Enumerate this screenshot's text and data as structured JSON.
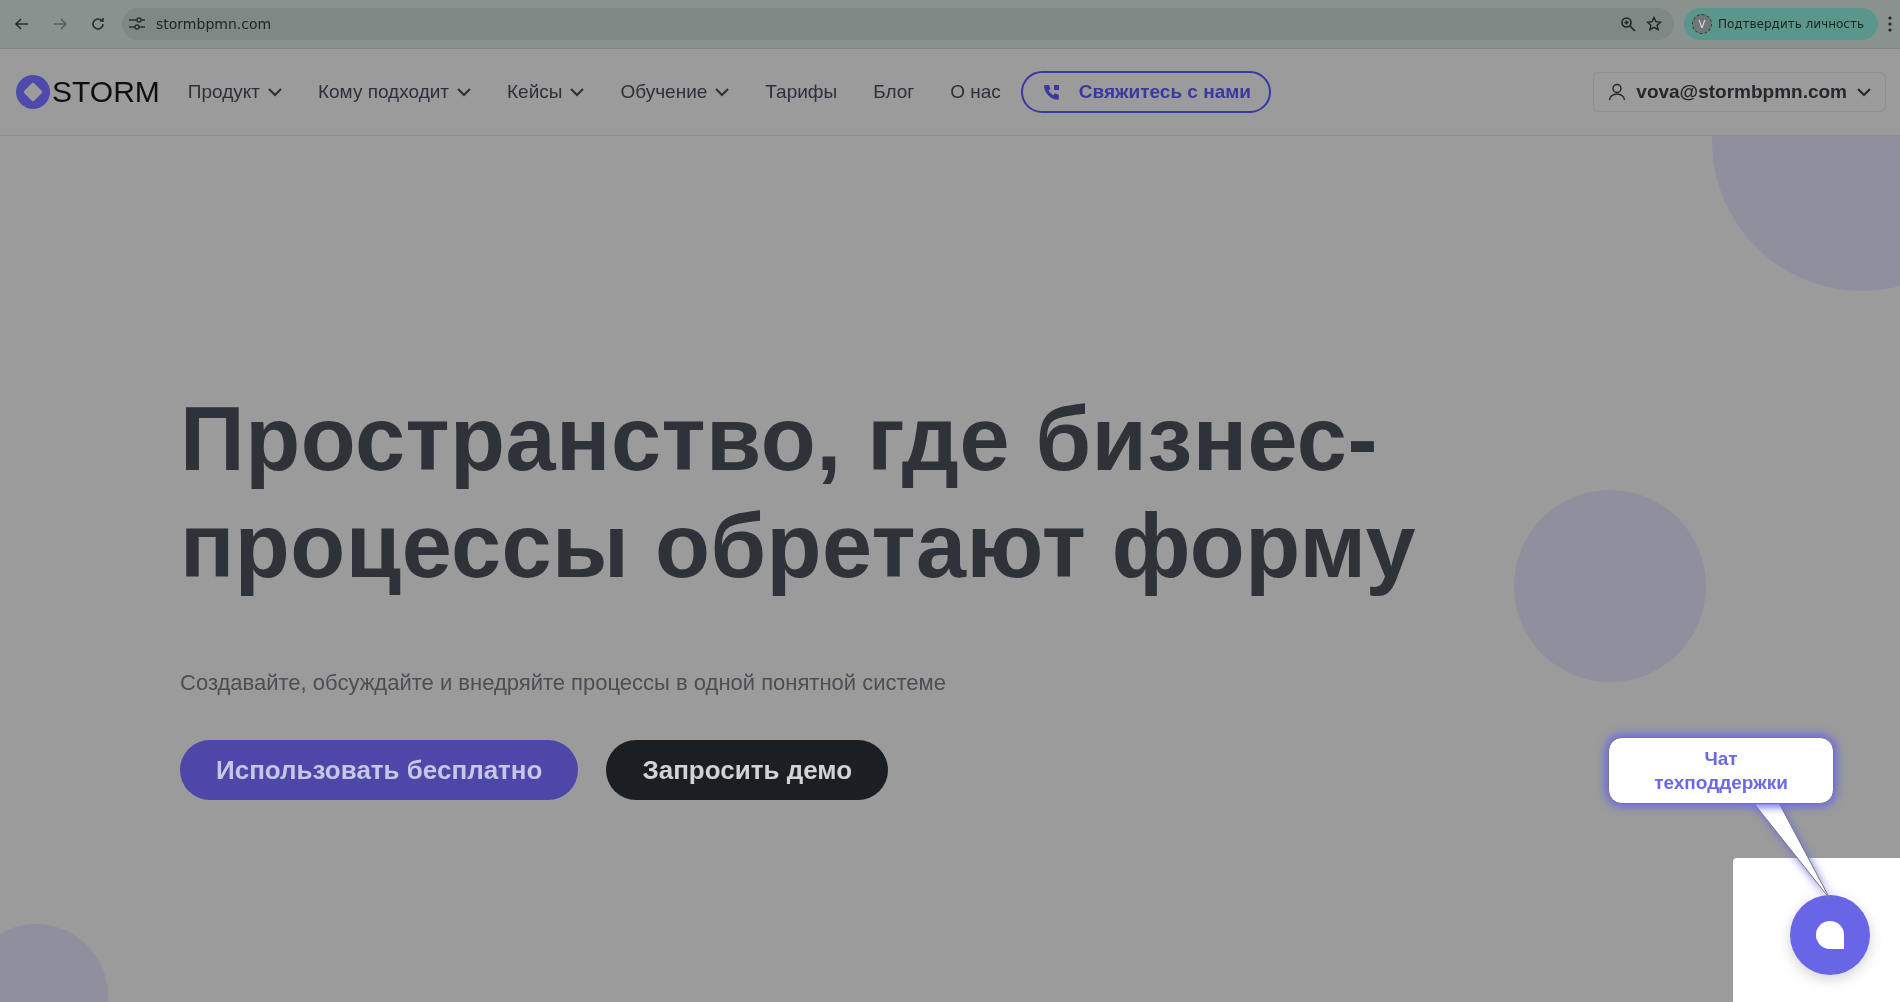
{
  "browser": {
    "url": "stormbpmn.com",
    "avatar": "V",
    "profile_button": "Подтвердить личность"
  },
  "nav": {
    "logo": "STORM",
    "items": [
      {
        "label": "Продукт",
        "dropdown": true
      },
      {
        "label": "Кому подходит",
        "dropdown": true
      },
      {
        "label": "Кейсы",
        "dropdown": true
      },
      {
        "label": "Обучение",
        "dropdown": true
      },
      {
        "label": "Тарифы",
        "dropdown": false
      },
      {
        "label": "Блог",
        "dropdown": false
      },
      {
        "label": "О нас",
        "dropdown": false
      }
    ],
    "contact_button": "Свяжитесь с нами",
    "account": "vova@stormbpmn.com"
  },
  "hero": {
    "title_lines": [
      "Пространство, где бизнес-",
      "процессы обретают форму"
    ],
    "subtitle": "Создавайте, обсуждайте и внедряйте процессы в одной понятной системе",
    "buttons": [
      {
        "label": "Использовать бесплатно",
        "kind": "primary"
      },
      {
        "label": "Запросить демо",
        "kind": "dark"
      }
    ]
  },
  "callout": {
    "text": "Чат техподдержки"
  }
}
